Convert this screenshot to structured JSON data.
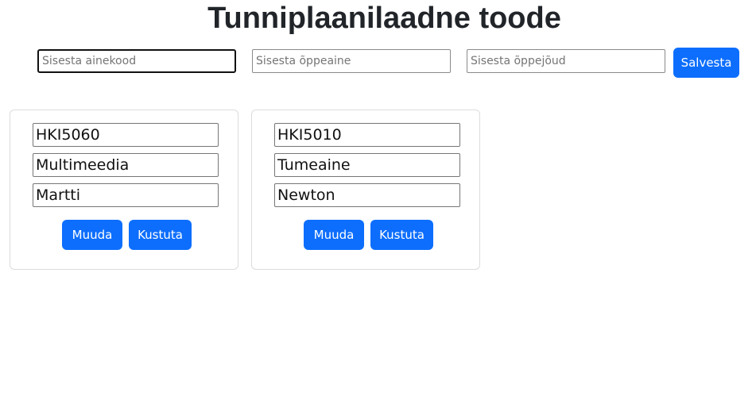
{
  "header": {
    "title": "Tunniplaanilaadne toode"
  },
  "form": {
    "code_placeholder": "Sisesta ainekood",
    "subject_placeholder": "Sisesta õppeaine",
    "teacher_placeholder": "Sisesta õppejõud",
    "save_label": "Salvesta"
  },
  "cards": [
    {
      "code": "HKI5060",
      "subject": "Multimeedia",
      "teacher": "Martti",
      "edit_label": "Muuda",
      "delete_label": "Kustuta"
    },
    {
      "code": "HKI5010",
      "subject": "Tumeaine",
      "teacher": "Newton",
      "edit_label": "Muuda",
      "delete_label": "Kustuta"
    }
  ],
  "colors": {
    "primary": "#0d6efd",
    "text": "#212529",
    "card_border": "#dcdcdc"
  }
}
